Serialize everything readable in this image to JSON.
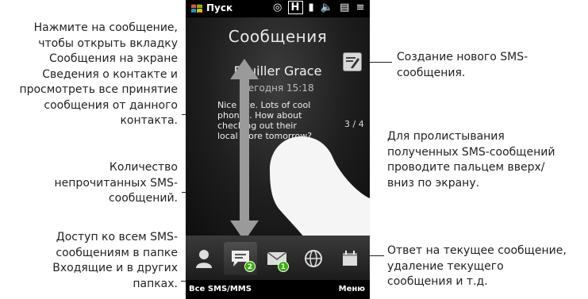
{
  "callouts": {
    "open_contact_tab": [
      "Нажмите на сообщение,",
      "чтобы открыть вкладку",
      "Сообщения на экране",
      "Сведения о контакте и",
      "просмотреть все принятие",
      "сообщения от данного",
      "контакта."
    ],
    "unread_count": [
      "Количество",
      "непрочитанных SMS-",
      "сообщений."
    ],
    "all_messages": [
      "Доступ ко всем SMS-",
      "сообщениям в папке",
      "Входящие и в других",
      "папках."
    ],
    "new_sms": [
      "Создание нового SMS-",
      "сообщения."
    ],
    "swipe": [
      "Для пролистывания",
      "полученных SMS-сообщений",
      "проводите пальцем вверх/",
      "вниз по экрану."
    ],
    "menu": [
      "Ответ на текущее сообщение,",
      "удаление текущего",
      "сообщения и т.д."
    ]
  },
  "statusbar": {
    "start_label": "Пуск",
    "icons": [
      "chat-icon",
      "h-data-icon",
      "signal-icon",
      "speaker-icon",
      "battery-icon",
      "menu-icon"
    ]
  },
  "screen": {
    "title": "Сообщения",
    "contact_name": "Fouiller Grace",
    "time": "Сегодня 15:18",
    "message": "Nice site. Lots of cool phones. How about checking out their local store tomorrow?",
    "counter": "3 / 4"
  },
  "tabs": [
    {
      "name": "contact-tab",
      "icon": "person-icon"
    },
    {
      "name": "sms-tab",
      "icon": "sms-bubble-icon",
      "badge": "2"
    },
    {
      "name": "email-tab",
      "icon": "envelope-icon",
      "badge": "1"
    },
    {
      "name": "internet-tab",
      "icon": "globe-icon"
    },
    {
      "name": "calendar-tab",
      "icon": "calendar-icon"
    }
  ],
  "softkeys": {
    "left": "Все SMS/MMS",
    "right": "Меню"
  },
  "colors": {
    "badge": "#35b300",
    "windows_flag": [
      "#f25022",
      "#7fba00",
      "#00a4ef",
      "#ffb900"
    ]
  }
}
